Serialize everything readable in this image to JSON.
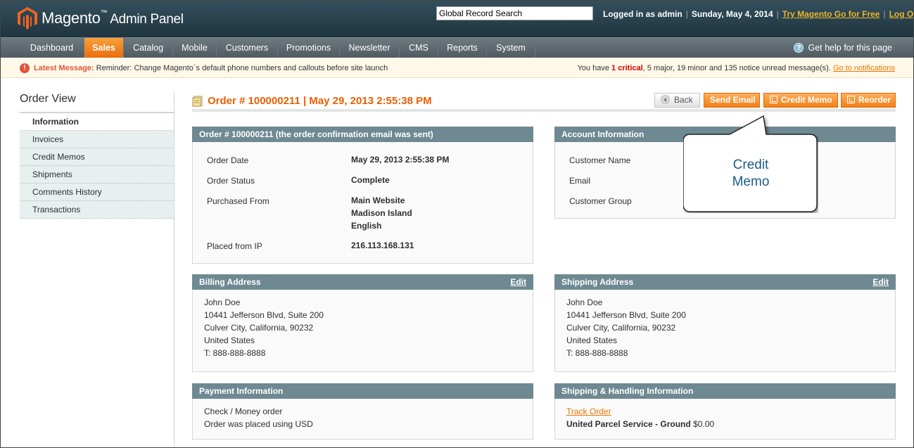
{
  "header": {
    "logo_brand": "Magento",
    "logo_tm": "™",
    "logo_suffix": "Admin Panel",
    "search_value": "Global Record Search",
    "logged_in": "Logged in as admin",
    "date": "Sunday, May 4, 2014",
    "try_link": "Try Magento Go for Free",
    "logout": "Log Out"
  },
  "nav": {
    "items": [
      "Dashboard",
      "Sales",
      "Catalog",
      "Mobile",
      "Customers",
      "Promotions",
      "Newsletter",
      "CMS",
      "Reports",
      "System"
    ],
    "active": "Sales",
    "help": "Get help for this page"
  },
  "message": {
    "label": "Latest Message:",
    "text": "Reminder: Change Magento`s default phone numbers and callouts before site launch",
    "summary_prefix": "You have",
    "critical_count": "1 critical",
    "rest": ", 5 major, 19 minor and 135 notice unread message(s).",
    "link": "Go to notifications",
    "critical_color": "#dd0000"
  },
  "sidebar": {
    "title": "Order View",
    "items": [
      "Information",
      "Invoices",
      "Credit Memos",
      "Shipments",
      "Comments History",
      "Transactions"
    ],
    "active": "Information"
  },
  "page": {
    "title": "Order # 100000211 | May 29, 2013 2:55:38 PM",
    "buttons": {
      "back": "Back",
      "send_email": "Send Email",
      "credit_memo": "Credit Memo",
      "reorder": "Reorder"
    },
    "accent": "#eb5e00"
  },
  "order_box": {
    "title": "Order # 100000211 (the order confirmation email was sent)",
    "rows": [
      {
        "label": "Order Date",
        "value": "May 29, 2013 2:55:38 PM"
      },
      {
        "label": "Order Status",
        "value": "Complete"
      },
      {
        "label": "Purchased From",
        "value_lines": [
          "Main Website",
          "Madison Island",
          "English"
        ]
      },
      {
        "label": "Placed from IP",
        "value": "216.113.168.131"
      }
    ]
  },
  "account_box": {
    "title": "Account Information",
    "labels": [
      "Customer Name",
      "Email",
      "Customer Group"
    ]
  },
  "billing": {
    "title": "Billing Address",
    "edit": "Edit",
    "lines": [
      "John Doe",
      "10441 Jefferson Blvd, Suite 200",
      "Culver City, California, 90232",
      "United States",
      "T: 888-888-8888"
    ]
  },
  "shipping": {
    "title": "Shipping Address",
    "edit": "Edit",
    "lines": [
      "John Doe",
      "10441 Jefferson Blvd, Suite 200",
      "Culver City, California, 90232",
      "United States",
      "T: 888-888-8888"
    ]
  },
  "payment": {
    "title": "Payment Information",
    "lines": [
      "Check / Money order",
      "Order was placed using USD"
    ]
  },
  "shipping_handling": {
    "title": "Shipping & Handling Information",
    "track": "Track Order",
    "carrier": "United Parcel Service - Ground",
    "price": "$0.00"
  },
  "callout": {
    "line1": "Credit",
    "line2": "Memo"
  }
}
